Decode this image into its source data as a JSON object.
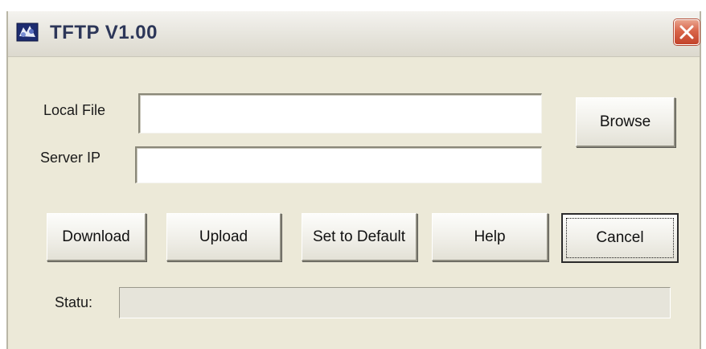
{
  "window": {
    "title": "TFTP V1.00",
    "app_icon": "tftp-app-icon",
    "close_icon": "close-icon"
  },
  "form": {
    "local_file": {
      "label": "Local File",
      "value": "",
      "placeholder": ""
    },
    "server_ip": {
      "label": "Server IP",
      "value": "",
      "placeholder": ""
    },
    "browse_label": "Browse"
  },
  "buttons": {
    "download": "Download",
    "upload": "Upload",
    "set_default": "Set to Default",
    "help": "Help",
    "cancel": "Cancel"
  },
  "status": {
    "label": "Statu:",
    "value": ""
  },
  "colors": {
    "window_bg": "#ece9d8",
    "title_text": "#2c3658",
    "close_button": "#d9654a"
  }
}
